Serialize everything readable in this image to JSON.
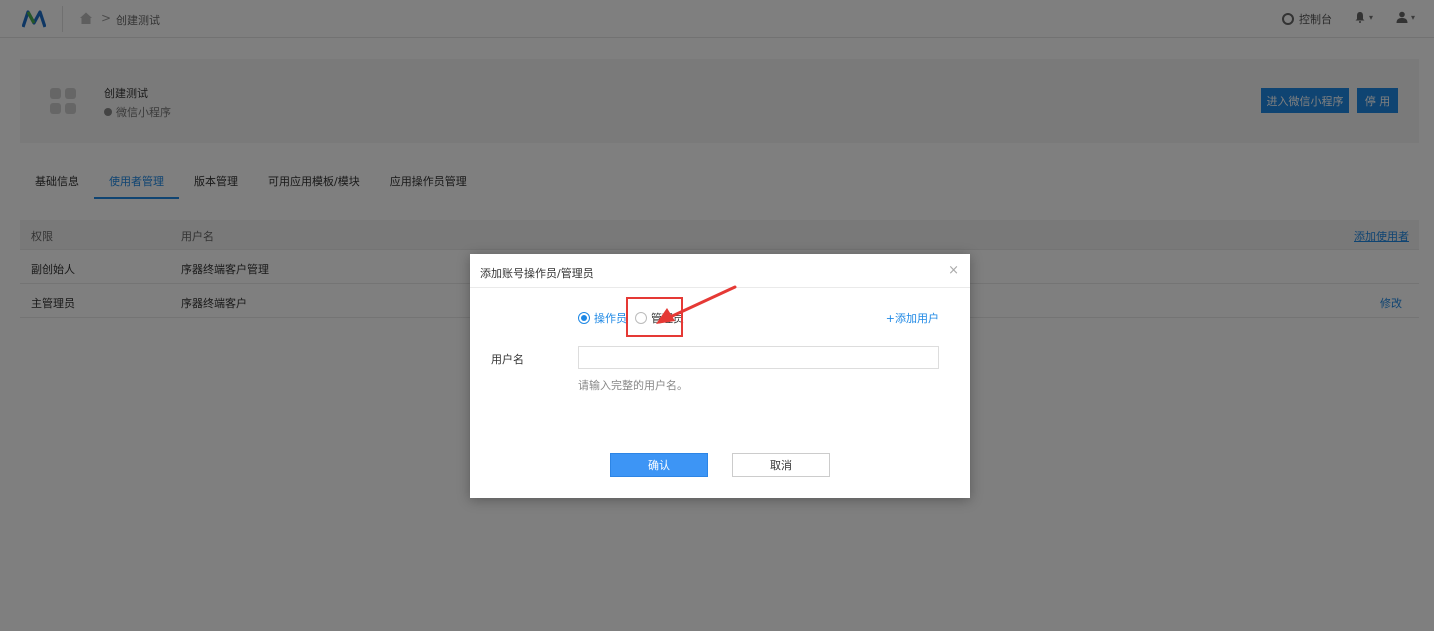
{
  "topbar": {
    "breadcrumb_current": "创建测试",
    "breadcrumb_sep": ">",
    "console_label": "控制台",
    "caret": "▾"
  },
  "app": {
    "name": "创建测试",
    "type": "微信小程序",
    "enter_button": "进入微信小程序",
    "stop_button": "停 用"
  },
  "tabs": [
    {
      "label": "基础信息"
    },
    {
      "label": "使用者管理"
    },
    {
      "label": "版本管理"
    },
    {
      "label": "可用应用模板/模块"
    },
    {
      "label": "应用操作员管理"
    }
  ],
  "table": {
    "headers": [
      "权限",
      "用户名"
    ],
    "add_link": "添加使用者",
    "rows": [
      {
        "role": "副创始人",
        "username": "序器终端客户管理",
        "action": ""
      },
      {
        "role": "主管理员",
        "username": "序器终端客户",
        "action": "修改"
      }
    ]
  },
  "modal": {
    "title": "添加账号操作员/管理员",
    "close": "×",
    "radios": [
      {
        "label": "操作员",
        "checked": true
      },
      {
        "label": "管理员",
        "checked": false
      }
    ],
    "add_user_link": "+添加用户",
    "field_label": "用户名",
    "field_value": "",
    "field_hint": "请输入完整的用户名。",
    "confirm": "确认",
    "cancel": "取消"
  },
  "colors": {
    "accent": "#1e88e5",
    "annotation": "#e53935"
  }
}
